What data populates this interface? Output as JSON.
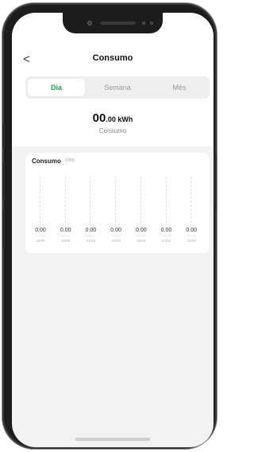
{
  "header": {
    "back_icon": "chevron-left-icon",
    "back_glyph": "<",
    "title": "Consumo"
  },
  "tabs": [
    {
      "label": "Dia",
      "active": true
    },
    {
      "label": "Semana",
      "active": false
    },
    {
      "label": "Mês",
      "active": false
    }
  ],
  "summary": {
    "value_int": "00",
    "value_dec": ".00 kWh",
    "label": "Consumo"
  },
  "chart_card": {
    "title": "Consumo",
    "unit": "kWh",
    "bars": [
      {
        "value": "0.00",
        "date": "19/09"
      },
      {
        "value": "0.00",
        "date": "20/09"
      },
      {
        "value": "0.00",
        "date": "21/09"
      },
      {
        "value": "0.00",
        "date": "22/09"
      },
      {
        "value": "0.00",
        "date": "23/09"
      },
      {
        "value": "0.00",
        "date": "24/09"
      },
      {
        "value": "0.00",
        "date": "25/09"
      }
    ]
  },
  "colors": {
    "accent": "#1aa64a",
    "background": "#f2f2f4",
    "card": "#ffffff"
  }
}
